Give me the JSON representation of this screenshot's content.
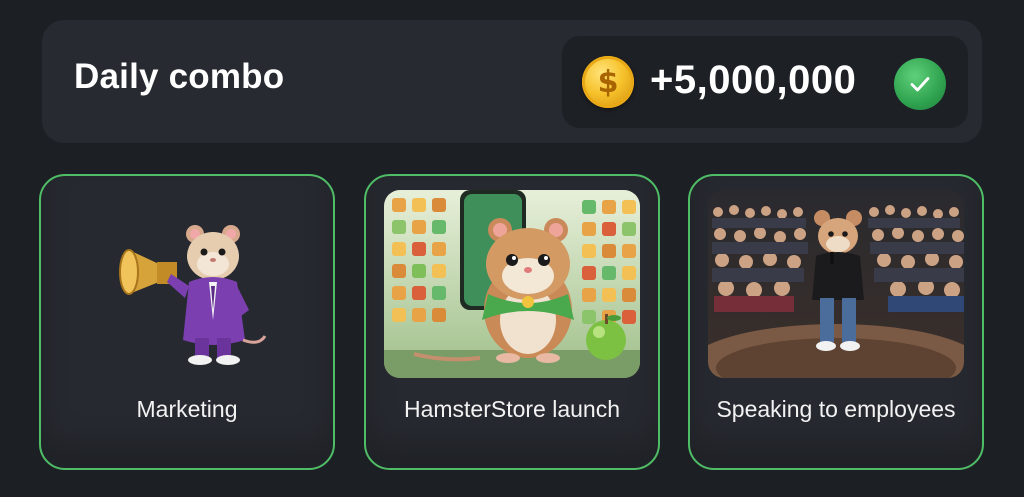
{
  "header": {
    "title": "Daily combo",
    "reward_amount": "+5,000,000",
    "coin_icon": "coin-icon",
    "check_icon": "checkmark-icon"
  },
  "cards": [
    {
      "label": "Marketing",
      "image": "hamster-megaphone-illustration"
    },
    {
      "label": "HamsterStore launch",
      "image": "hamster-app-store-illustration"
    },
    {
      "label": "Speaking to employees",
      "image": "hamster-speaking-crowd-illustration"
    }
  ],
  "colors": {
    "background": "#1c1f24",
    "panel": "#272a30",
    "card_border": "#4fbd66",
    "coin": "#f6c22b",
    "check": "#2fa24f"
  }
}
